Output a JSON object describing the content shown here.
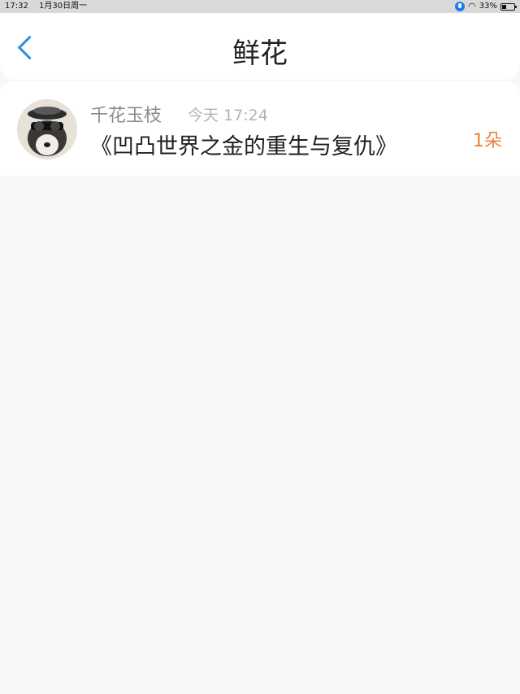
{
  "status_bar": {
    "time": "17:32",
    "date": "1月30日周一",
    "battery": "33%"
  },
  "nav": {
    "title": "鲜花"
  },
  "feed": [
    {
      "username": "千花玉枝",
      "time": "今天 17:24",
      "book_title": "《凹凸世界之金的重生与复仇》",
      "count": "1朵"
    }
  ],
  "colors": {
    "accent_blue": "#2f8fe4",
    "accent_orange": "#ee7f3c"
  },
  "icons": {
    "back": "chevron-left-icon",
    "mic": "mic-icon",
    "wifi": "wifi-icon",
    "battery": "battery-icon"
  }
}
